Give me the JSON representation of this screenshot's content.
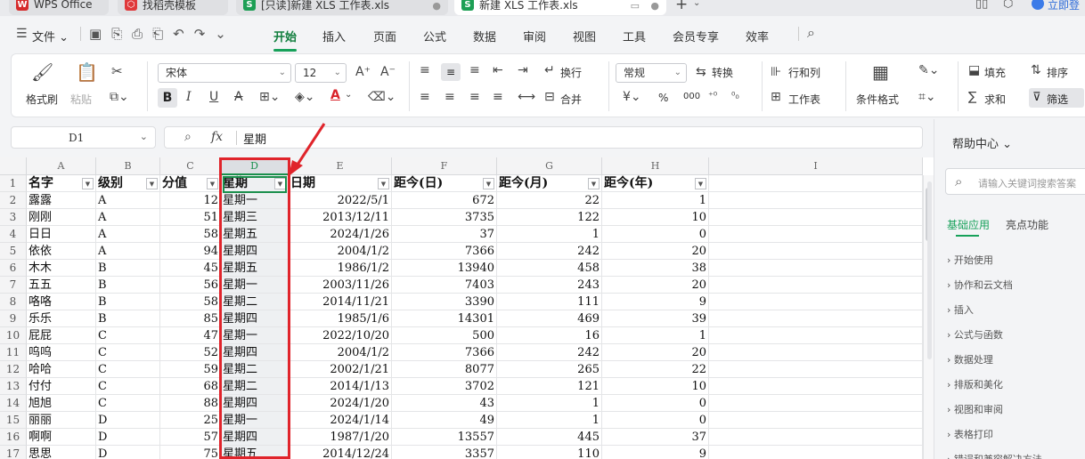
{
  "tabs": [
    {
      "label": "WPS Office"
    },
    {
      "label": "找稻壳模板"
    },
    {
      "label": "[只读]新建 XLS 工作表.xls"
    },
    {
      "label": "新建 XLS 工作表.xls"
    }
  ],
  "topright": {
    "login": "立即登"
  },
  "menu": {
    "file": "文件",
    "items": [
      "开始",
      "插入",
      "页面",
      "公式",
      "数据",
      "审阅",
      "视图",
      "工具",
      "会员专享",
      "效率"
    ]
  },
  "ribbon": {
    "format_painter": "格式刷",
    "paste": "粘贴",
    "font": "宋体",
    "size": "12",
    "wrap": "换行",
    "merge": "合并",
    "number_format": "常规",
    "convert": "转换",
    "rows_cols": "行和列",
    "worksheet": "工作表",
    "cond_format": "条件格式",
    "fill": "填充",
    "sort": "排序",
    "sum": "求和",
    "filter": "筛选",
    "percent": "%",
    "thousands": "000"
  },
  "formula": {
    "cell_ref": "D1",
    "fx": "fx",
    "content": "星期"
  },
  "columns": [
    "A",
    "B",
    "C",
    "D",
    "E",
    "F",
    "G",
    "H",
    "I"
  ],
  "table": {
    "headers": [
      "名字",
      "级别",
      "分值",
      "星期",
      "日期",
      "距今(日)",
      "距今(月)",
      "距今(年)"
    ],
    "rows": [
      [
        "露露",
        "A",
        "12",
        "星期一",
        "2022/5/1",
        "672",
        "22",
        "1"
      ],
      [
        "刚刚",
        "A",
        "51",
        "星期三",
        "2013/12/11",
        "3735",
        "122",
        "10"
      ],
      [
        "日日",
        "A",
        "58",
        "星期五",
        "2024/1/26",
        "37",
        "1",
        "0"
      ],
      [
        "依依",
        "A",
        "94",
        "星期四",
        "2004/1/2",
        "7366",
        "242",
        "20"
      ],
      [
        "木木",
        "B",
        "45",
        "星期五",
        "1986/1/2",
        "13940",
        "458",
        "38"
      ],
      [
        "五五",
        "B",
        "56",
        "星期一",
        "2003/11/26",
        "7403",
        "243",
        "20"
      ],
      [
        "咯咯",
        "B",
        "58",
        "星期二",
        "2014/11/21",
        "3390",
        "111",
        "9"
      ],
      [
        "乐乐",
        "B",
        "85",
        "星期四",
        "1985/1/6",
        "14301",
        "469",
        "39"
      ],
      [
        "屁屁",
        "C",
        "47",
        "星期一",
        "2022/10/20",
        "500",
        "16",
        "1"
      ],
      [
        "呜呜",
        "C",
        "52",
        "星期四",
        "2004/1/2",
        "7366",
        "242",
        "20"
      ],
      [
        "哈哈",
        "C",
        "59",
        "星期二",
        "2002/1/21",
        "8077",
        "265",
        "22"
      ],
      [
        "付付",
        "C",
        "68",
        "星期二",
        "2014/1/13",
        "3702",
        "121",
        "10"
      ],
      [
        "旭旭",
        "C",
        "88",
        "星期四",
        "2024/1/20",
        "43",
        "1",
        "0"
      ],
      [
        "丽丽",
        "D",
        "25",
        "星期一",
        "2024/1/14",
        "49",
        "1",
        "0"
      ],
      [
        "啊啊",
        "D",
        "57",
        "星期四",
        "1987/1/20",
        "13557",
        "445",
        "37"
      ],
      [
        "思思",
        "D",
        "75",
        "星期五",
        "2014/12/24",
        "3357",
        "110",
        "9"
      ]
    ]
  },
  "help": {
    "title": "帮助中心",
    "search_placeholder": "请输入关键词搜索答案",
    "tabs": [
      "基础应用",
      "亮点功能"
    ],
    "items": [
      "开始使用",
      "协作和云文档",
      "插入",
      "公式与函数",
      "数据处理",
      "排版和美化",
      "视图和审阅",
      "表格打印",
      "错误和兼容解决方法"
    ]
  },
  "colors": {
    "accent": "#17a15a",
    "highlight_box": "#e0242b"
  }
}
